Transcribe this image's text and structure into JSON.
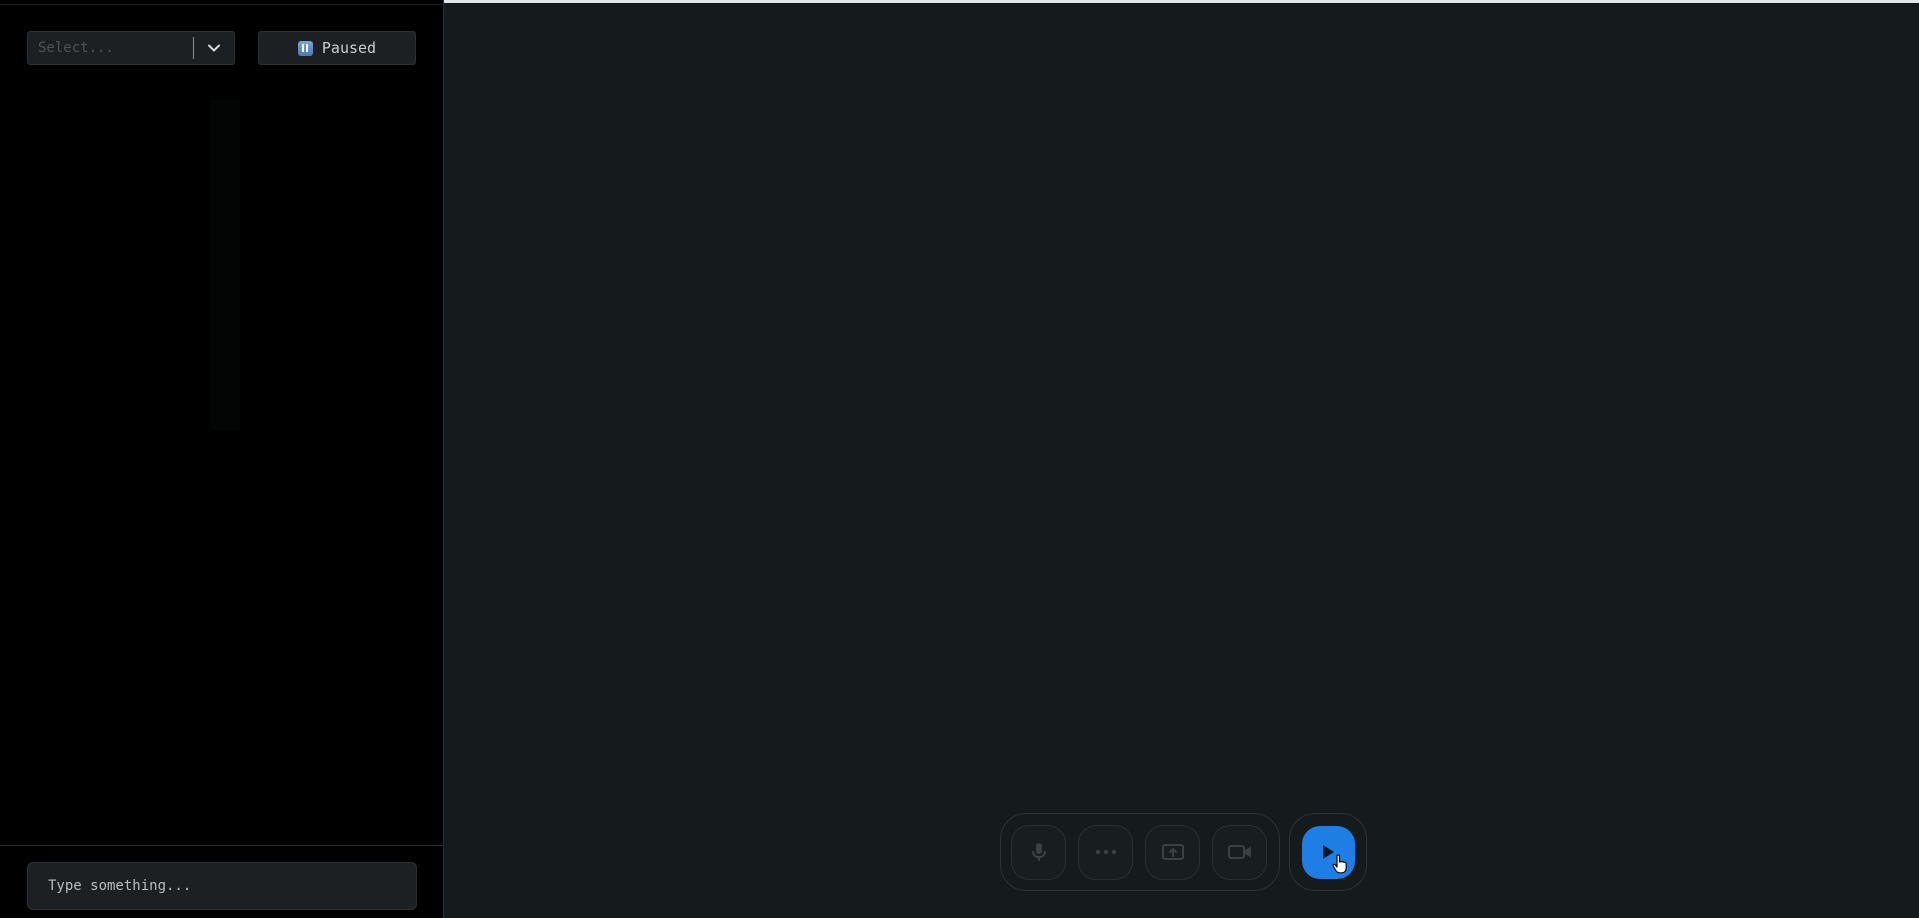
{
  "sidebar": {
    "select": {
      "placeholder": "Select...",
      "icon": "chevron-down-icon"
    },
    "stream_status": {
      "label": "Paused",
      "icon": "pause-icon",
      "icon_color": "#6a93c9"
    },
    "chat_input": {
      "placeholder": "Type something..."
    }
  },
  "control_tray": {
    "buttons": [
      {
        "name": "microphone",
        "icon": "microphone-icon"
      },
      {
        "name": "more",
        "icon": "more-dots-icon"
      },
      {
        "name": "screen-share",
        "icon": "screen-share-icon"
      },
      {
        "name": "webcam",
        "icon": "video-camera-icon"
      }
    ],
    "connect": {
      "icon": "play-icon",
      "color": "#1f7ee6"
    }
  },
  "colors": {
    "sidebar_bg": "#000000",
    "main_bg": "#151a1c",
    "accent": "#1f7ee6"
  }
}
